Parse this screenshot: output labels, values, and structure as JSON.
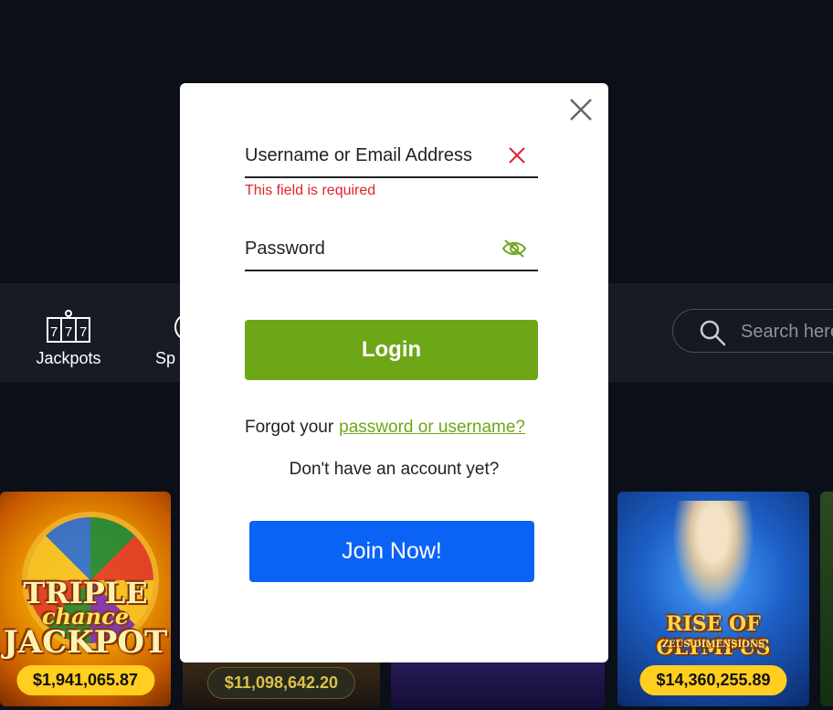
{
  "nav": {
    "items": [
      {
        "label": "Jackpots",
        "icon": "slot-machine-icon"
      },
      {
        "label": "Sp",
        "icon": "sports-icon"
      }
    ],
    "search_placeholder": "Search here"
  },
  "games": [
    {
      "title_line1": "TRIPLE",
      "title_line2": "chance",
      "title_line3": "JACKPOT",
      "jackpot": "$1,941,065.87"
    },
    {
      "jackpot": "$11,098,642.20"
    },
    {
      "jackpot": ""
    },
    {
      "title_line1": "RISE OF OLYMPUS",
      "title_line2": "ZEUS DIMENSIONS",
      "jackpot": "$14,360,255.89"
    }
  ],
  "modal": {
    "username_label": "Username or Email Address",
    "username_error": "This field is required",
    "password_label": "Password",
    "login_label": "Login",
    "forgot_text": "Forgot your",
    "forgot_link": "password or username?",
    "no_account_text": "Don't have an account yet?",
    "join_label": "Join Now!"
  },
  "colors": {
    "accent_green": "#6da718",
    "join_blue": "#0b63f6",
    "error_red": "#e0242c",
    "jackpot_yellow": "#ffce1f"
  }
}
